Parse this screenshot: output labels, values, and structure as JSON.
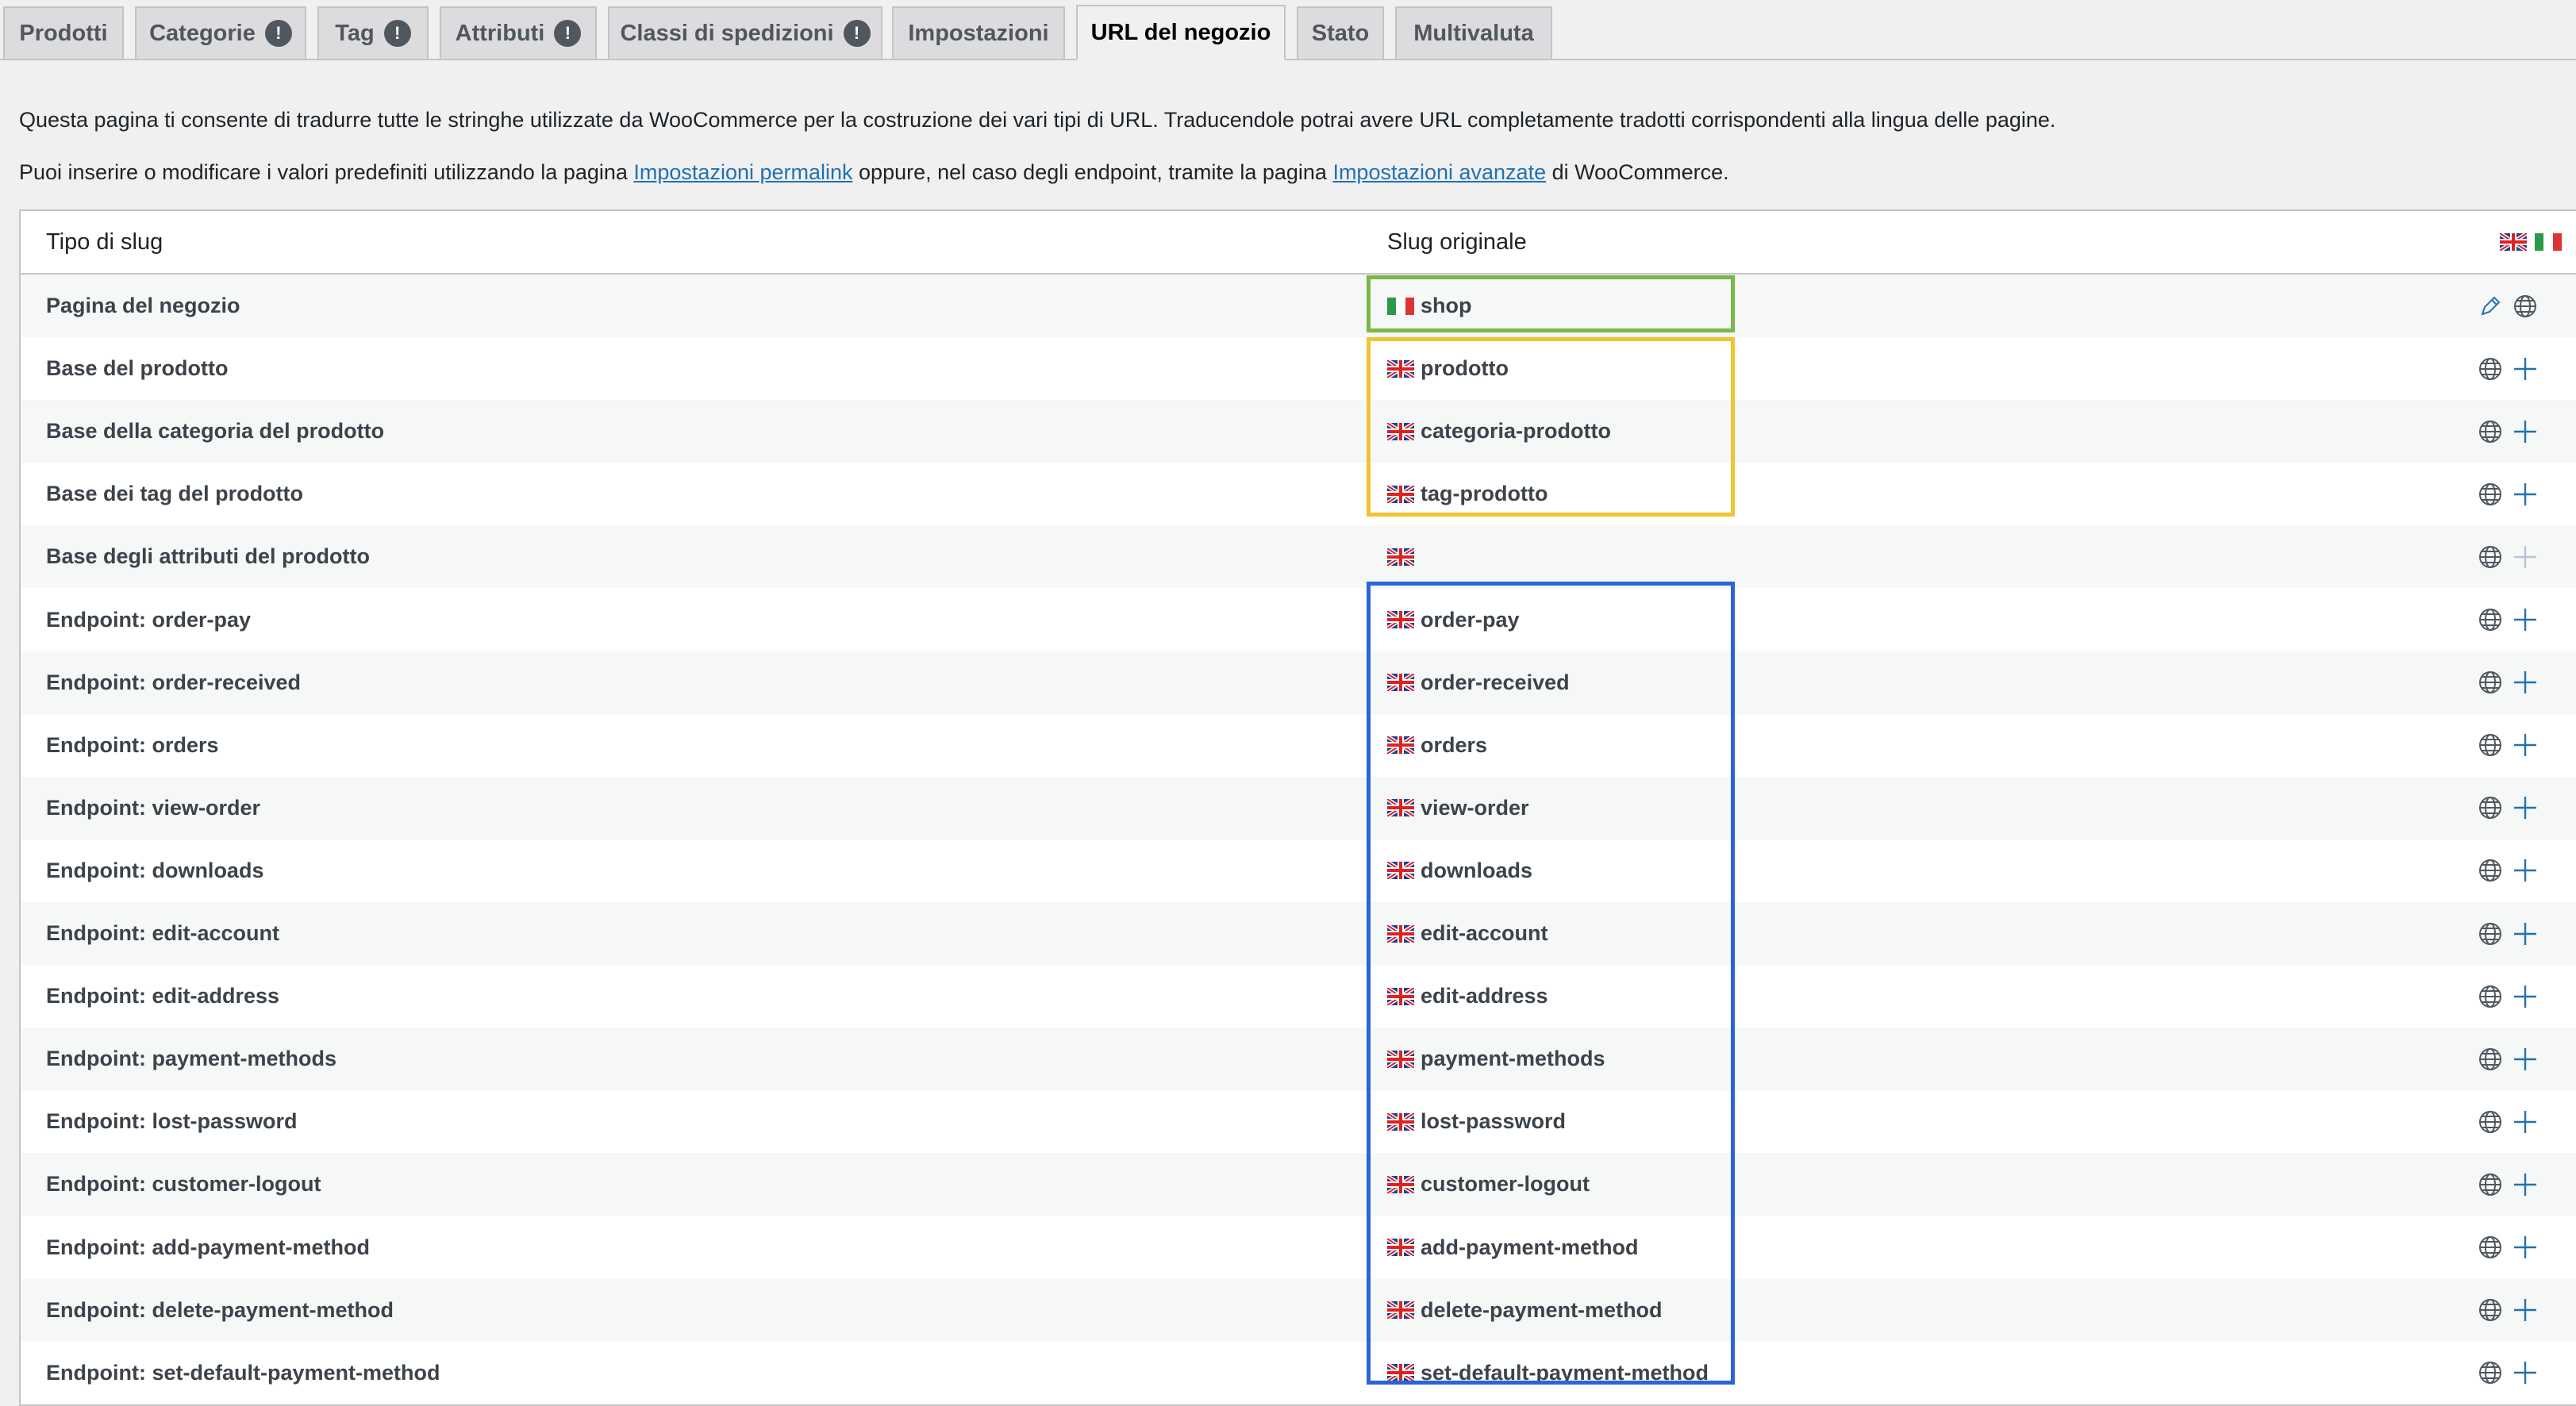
{
  "tabs": [
    {
      "label": "Prodotti",
      "badge": ""
    },
    {
      "label": "Categorie",
      "badge": "!"
    },
    {
      "label": "Tag",
      "badge": "!"
    },
    {
      "label": "Attributi",
      "badge": "!"
    },
    {
      "label": "Classi di spedizioni",
      "badge": "!"
    },
    {
      "label": "Impostazioni",
      "badge": ""
    },
    {
      "label": "URL del negozio",
      "badge": "",
      "active": true
    },
    {
      "label": "Stato",
      "badge": ""
    },
    {
      "label": "Multivaluta",
      "badge": ""
    }
  ],
  "intro": {
    "line1": "Questa pagina ti consente di tradurre tutte le stringhe utilizzate da WooCommerce per la costruzione dei vari tipi di URL. Traducendole potrai avere URL completamente tradotti corrispondenti alla lingua delle pagine.",
    "line2_a": "Puoi inserire o modificare i valori predefiniti utilizzando la pagina ",
    "line2_link1": "Impostazioni permalink",
    "line2_b": " oppure, nel caso degli endpoint, tramite la pagina ",
    "line2_link2": "Impostazioni avanzate",
    "line2_c": " di WooCommerce."
  },
  "table": {
    "col_type": "Tipo di slug",
    "col_slug": "Slug originale",
    "rows": [
      {
        "type": "Pagina del negozio",
        "slug": "shop",
        "flag": "it",
        "actions": [
          "pencil-icon",
          "globe-icon"
        ]
      },
      {
        "type": "Base del prodotto",
        "slug": "prodotto",
        "flag": "gb",
        "actions": [
          "globe-icon",
          "plus-icon"
        ]
      },
      {
        "type": "Base della categoria del prodotto",
        "slug": "categoria-prodotto",
        "flag": "gb",
        "actions": [
          "globe-icon",
          "plus-icon"
        ]
      },
      {
        "type": "Base dei tag del prodotto",
        "slug": "tag-prodotto",
        "flag": "gb",
        "actions": [
          "globe-icon",
          "plus-icon"
        ]
      },
      {
        "type": "Base degli attributi del prodotto",
        "slug": "",
        "flag": "gb",
        "actions": [
          "globe-icon",
          "plus-icon-disabled"
        ]
      },
      {
        "type": "Endpoint: order-pay",
        "slug": "order-pay",
        "flag": "gb",
        "actions": [
          "globe-icon",
          "plus-icon"
        ]
      },
      {
        "type": "Endpoint: order-received",
        "slug": "order-received",
        "flag": "gb",
        "actions": [
          "globe-icon",
          "plus-icon"
        ]
      },
      {
        "type": "Endpoint: orders",
        "slug": "orders",
        "flag": "gb",
        "actions": [
          "globe-icon",
          "plus-icon"
        ]
      },
      {
        "type": "Endpoint: view-order",
        "slug": "view-order",
        "flag": "gb",
        "actions": [
          "globe-icon",
          "plus-icon"
        ]
      },
      {
        "type": "Endpoint: downloads",
        "slug": "downloads",
        "flag": "gb",
        "actions": [
          "globe-icon",
          "plus-icon"
        ]
      },
      {
        "type": "Endpoint: edit-account",
        "slug": "edit-account",
        "flag": "gb",
        "actions": [
          "globe-icon",
          "plus-icon"
        ]
      },
      {
        "type": "Endpoint: edit-address",
        "slug": "edit-address",
        "flag": "gb",
        "actions": [
          "globe-icon",
          "plus-icon"
        ]
      },
      {
        "type": "Endpoint: payment-methods",
        "slug": "payment-methods",
        "flag": "gb",
        "actions": [
          "globe-icon",
          "plus-icon"
        ]
      },
      {
        "type": "Endpoint: lost-password",
        "slug": "lost-password",
        "flag": "gb",
        "actions": [
          "globe-icon",
          "plus-icon"
        ]
      },
      {
        "type": "Endpoint: customer-logout",
        "slug": "customer-logout",
        "flag": "gb",
        "actions": [
          "globe-icon",
          "plus-icon"
        ]
      },
      {
        "type": "Endpoint: add-payment-method",
        "slug": "add-payment-method",
        "flag": "gb",
        "actions": [
          "globe-icon",
          "plus-icon"
        ]
      },
      {
        "type": "Endpoint: delete-payment-method",
        "slug": "delete-payment-method",
        "flag": "gb",
        "actions": [
          "globe-icon",
          "plus-icon"
        ]
      },
      {
        "type": "Endpoint: set-default-payment-method",
        "slug": "set-default-payment-method",
        "flag": "gb",
        "actions": [
          "globe-icon",
          "plus-icon"
        ]
      }
    ]
  },
  "colors": {
    "highlight_green": "#7ab648",
    "highlight_yellow": "#f2c230",
    "highlight_blue": "#2b63d9",
    "link": "#2271b1"
  }
}
